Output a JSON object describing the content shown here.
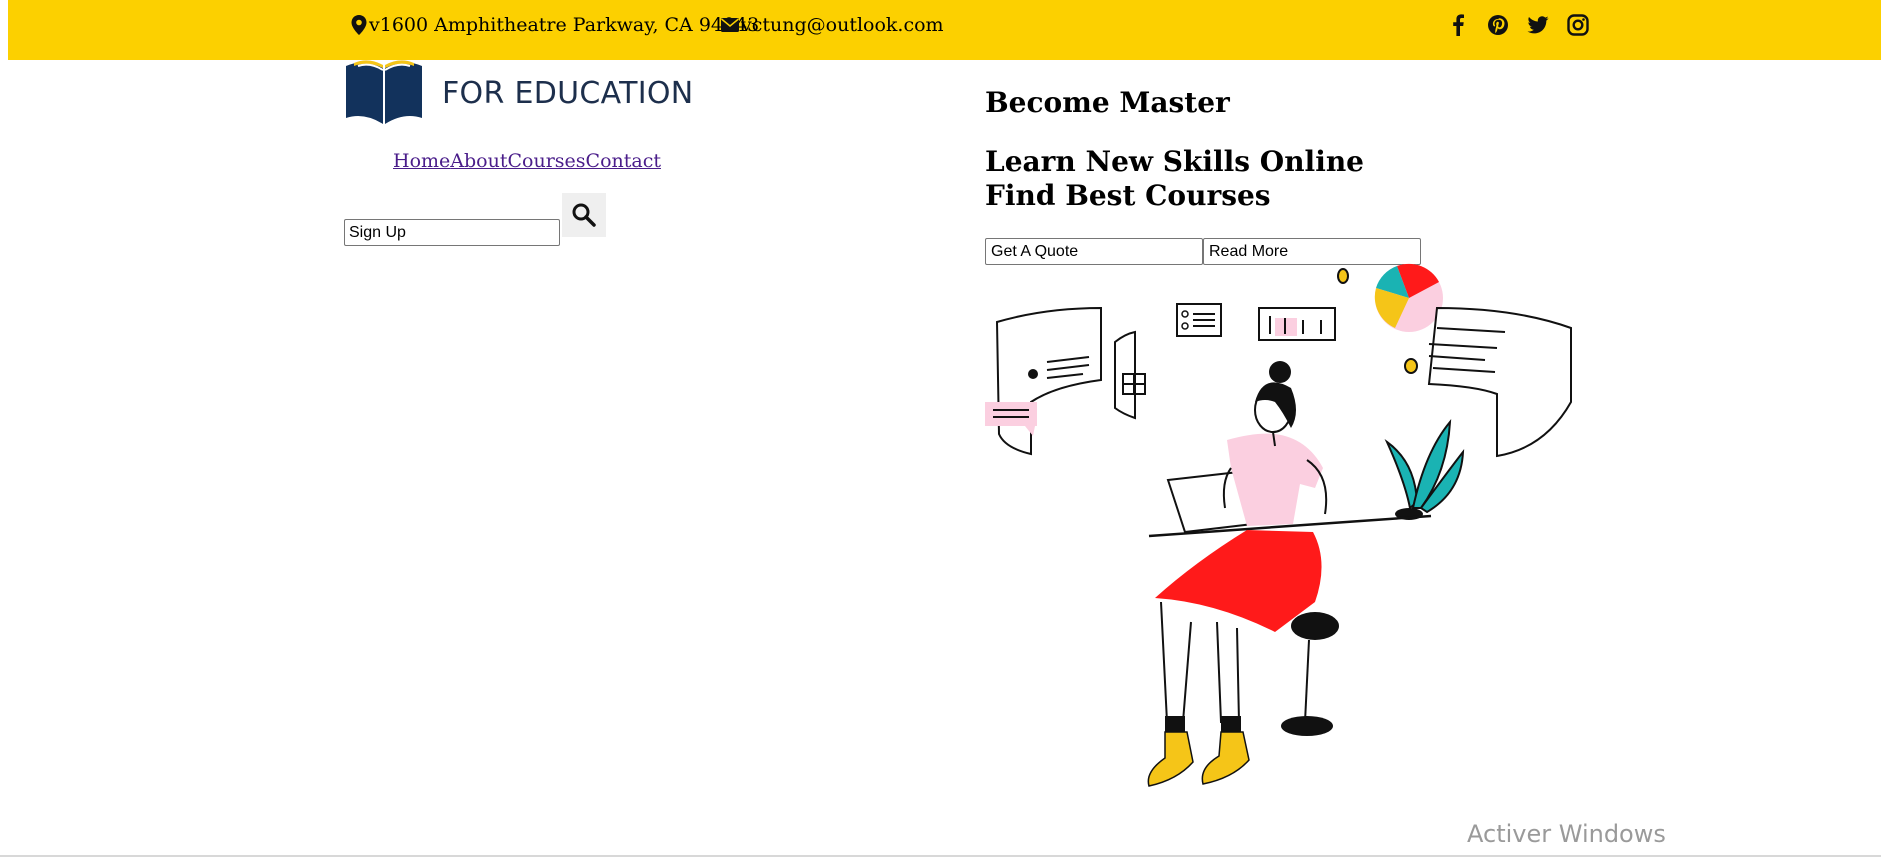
{
  "topbar": {
    "address": "v1600 Amphitheatre Parkway, CA 94043",
    "email": "vctung@outlook.com",
    "background": "#fcd000",
    "socials": [
      "facebook-icon",
      "pinterest-icon",
      "twitter-icon",
      "instagram-icon"
    ]
  },
  "logo": {
    "text": "FOR EDUCATION"
  },
  "nav": {
    "items": [
      "Home",
      "About",
      "Courses",
      "Contact"
    ]
  },
  "search": {
    "value": "Sign Up"
  },
  "hero": {
    "eyebrow": "Become Master",
    "headline_line1": "Learn New Skills Online",
    "headline_line2": "Find Best Courses",
    "quote_button": "Get A Quote",
    "read_more_button": "Read More"
  },
  "system": {
    "watermark": "Activer Windows"
  }
}
